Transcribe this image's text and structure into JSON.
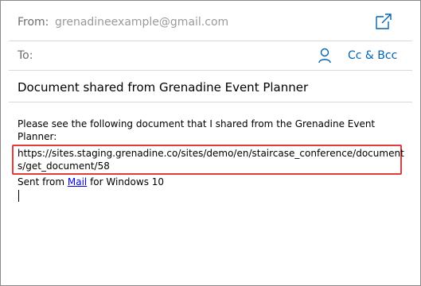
{
  "from": {
    "label": "From:",
    "address": "grenadineexample@gmail.com"
  },
  "to": {
    "label": "To:",
    "cc_bcc": "Cc & Bcc"
  },
  "subject": "Document shared from Grenadine Event Planner",
  "body": {
    "intro": "Please see the following document that I shared from the Grenadine Event Planner:",
    "url": "https://sites.staging.grenadine.co/sites/demo/en/staircase_conference/documents/get_document/58",
    "sent_prefix": "Sent from ",
    "sent_link": "Mail",
    "sent_suffix": " for Windows 10"
  },
  "colors": {
    "accent": "#0063b1",
    "highlight_border": "#e23b3b",
    "link": "#0000ee"
  },
  "icons": {
    "popout": "popout-icon",
    "contact": "person-icon"
  }
}
